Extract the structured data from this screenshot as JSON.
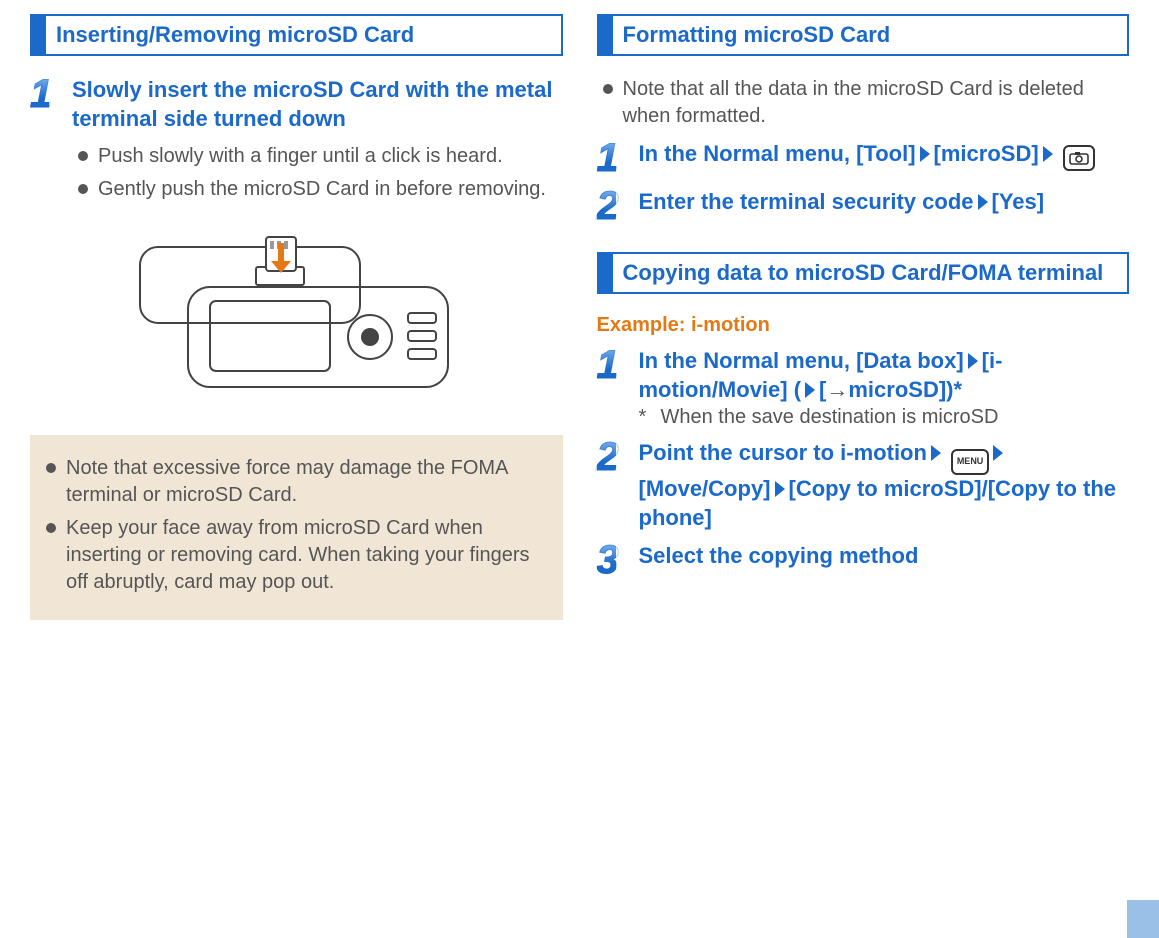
{
  "left": {
    "header": "Inserting/Removing microSD Card",
    "step1": {
      "num": "1",
      "title": "Slowly insert the microSD Card with the metal terminal side turned down",
      "bullets": [
        "Push slowly with a finger until a click is heard.",
        "Gently push the microSD Card in before removing."
      ]
    },
    "notes": [
      "Note that excessive force may damage the FOMA terminal or microSD Card.",
      "Keep your face away from microSD Card when inserting or removing card. When taking your fingers off abruptly, card may pop out."
    ]
  },
  "right": {
    "headerA": "Formatting microSD Card",
    "noteA": "Note that all the data in the microSD Card is deleted when formatted.",
    "format_steps": {
      "s1": {
        "num": "1",
        "parts": {
          "a": "In the Normal menu, [Tool]",
          "b": "[microSD]"
        }
      },
      "s2": {
        "num": "2",
        "parts": {
          "a": "Enter the terminal security code",
          "b": "[Yes]"
        }
      }
    },
    "headerB": "Copying data to microSD Card/FOMA terminal",
    "example_label": "Example: i-motion",
    "copy_steps": {
      "s1": {
        "num": "1",
        "parts": {
          "a": "In the Normal menu, [Data box]",
          "b": "[i-motion/Movie] (",
          "c": "[",
          "d": "microSD])*"
        },
        "footnote_ast": "*",
        "footnote": "When the save destination is microSD"
      },
      "s2": {
        "num": "2",
        "parts": {
          "a": "Point the cursor to i-motion",
          "b": "[Move/Copy]",
          "c": "[Copy to microSD]/[Copy to the phone]"
        },
        "menu_label": "MENU"
      },
      "s3": {
        "num": "3",
        "title": "Select the copying method"
      }
    }
  }
}
